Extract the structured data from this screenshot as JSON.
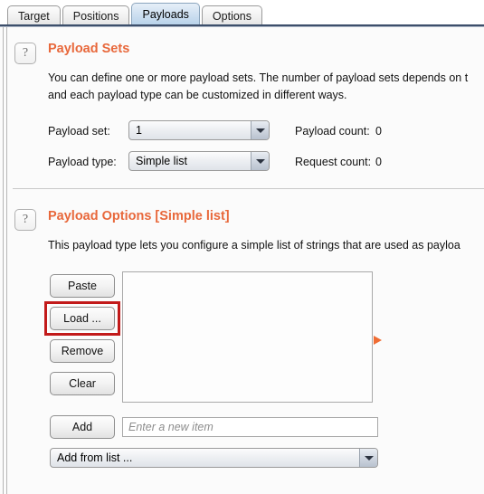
{
  "window": {
    "tabs": [
      {
        "label": "Target",
        "selected": false
      },
      {
        "label": "Positions",
        "selected": false
      },
      {
        "label": "Payloads",
        "selected": true
      },
      {
        "label": "Options",
        "selected": false
      }
    ]
  },
  "payload_sets": {
    "help_icon": "question-mark-icon",
    "title": "Payload Sets",
    "description_line1": "You can define one or more payload sets. The number of payload sets depends on t",
    "description_line2": "and each payload type can be customized in different ways.",
    "payload_set_label": "Payload set:",
    "payload_set_value": "1",
    "payload_type_label": "Payload type:",
    "payload_type_value": "Simple list",
    "payload_count_label": "Payload count:",
    "payload_count_value": "0",
    "request_count_label": "Request count:",
    "request_count_value": "0"
  },
  "payload_options": {
    "help_icon": "question-mark-icon",
    "title": "Payload Options [Simple list]",
    "description_line1": "This payload type lets you configure a simple list of strings that are used as payloa",
    "buttons": {
      "paste": "Paste",
      "load": "Load ...",
      "remove": "Remove",
      "clear": "Clear",
      "add": "Add"
    },
    "new_item_placeholder": "Enter a new item",
    "new_item_value": "",
    "add_from_list_value": "Add from list ...",
    "list_items": []
  },
  "annotations": {
    "highlight_target": "load-button",
    "highlight_color": "#c21a1a",
    "expand_arrow_color": "#ef6c33"
  }
}
